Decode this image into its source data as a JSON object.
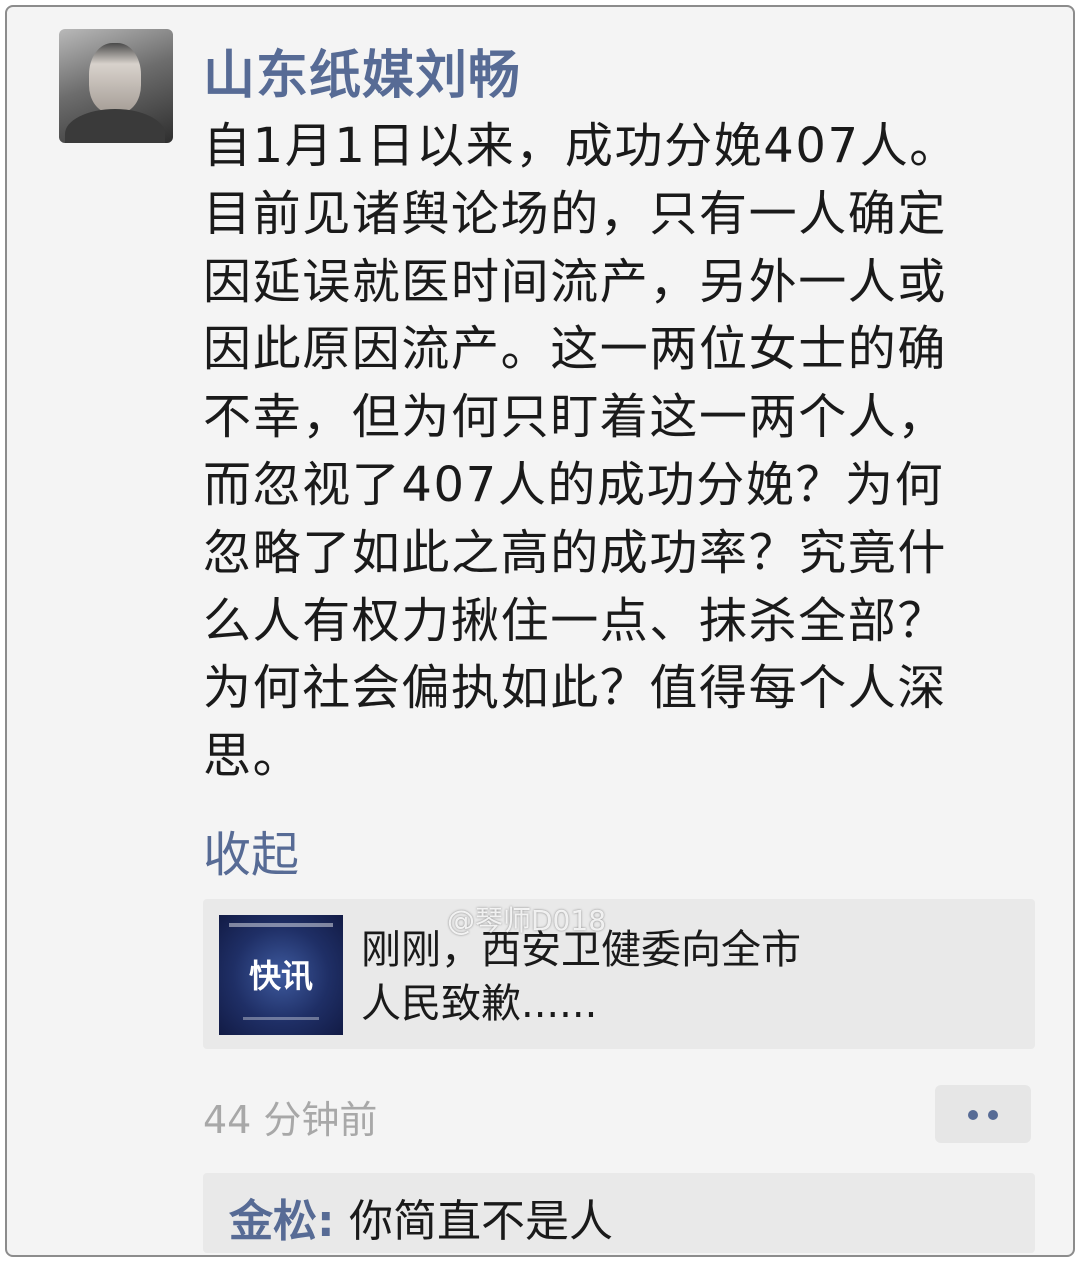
{
  "post": {
    "username": "山东纸媒刘畅",
    "text": "自1月1日以来，成功分娩407人。\n目前见诸舆论场的，只有一人确定\n因延误就医时间流产，另外一人或\n因此原因流产。这一两位女士的确\n不幸，但为何只盯着这一两个人，\n而忽视了407人的成功分娩？为何\n忽略了如此之高的成功率？究竟什\n么人有权力揪住一点、抹杀全部？\n为何社会偏执如此？值得每个人深\n思。",
    "collapse_label": "收起",
    "timestamp": "44 分钟前"
  },
  "link_card": {
    "thumbnail_text": "快讯",
    "title": "刚刚，西安卫健委向全市\n人民致歉......"
  },
  "watermark": "@琴师D018",
  "comment": {
    "commenter": "金松",
    "separator": ":",
    "text": "你简直不是人"
  },
  "colors": {
    "link_blue": "#576b95",
    "background": "#f4f4f4",
    "card_bg": "#e9e9e9"
  }
}
